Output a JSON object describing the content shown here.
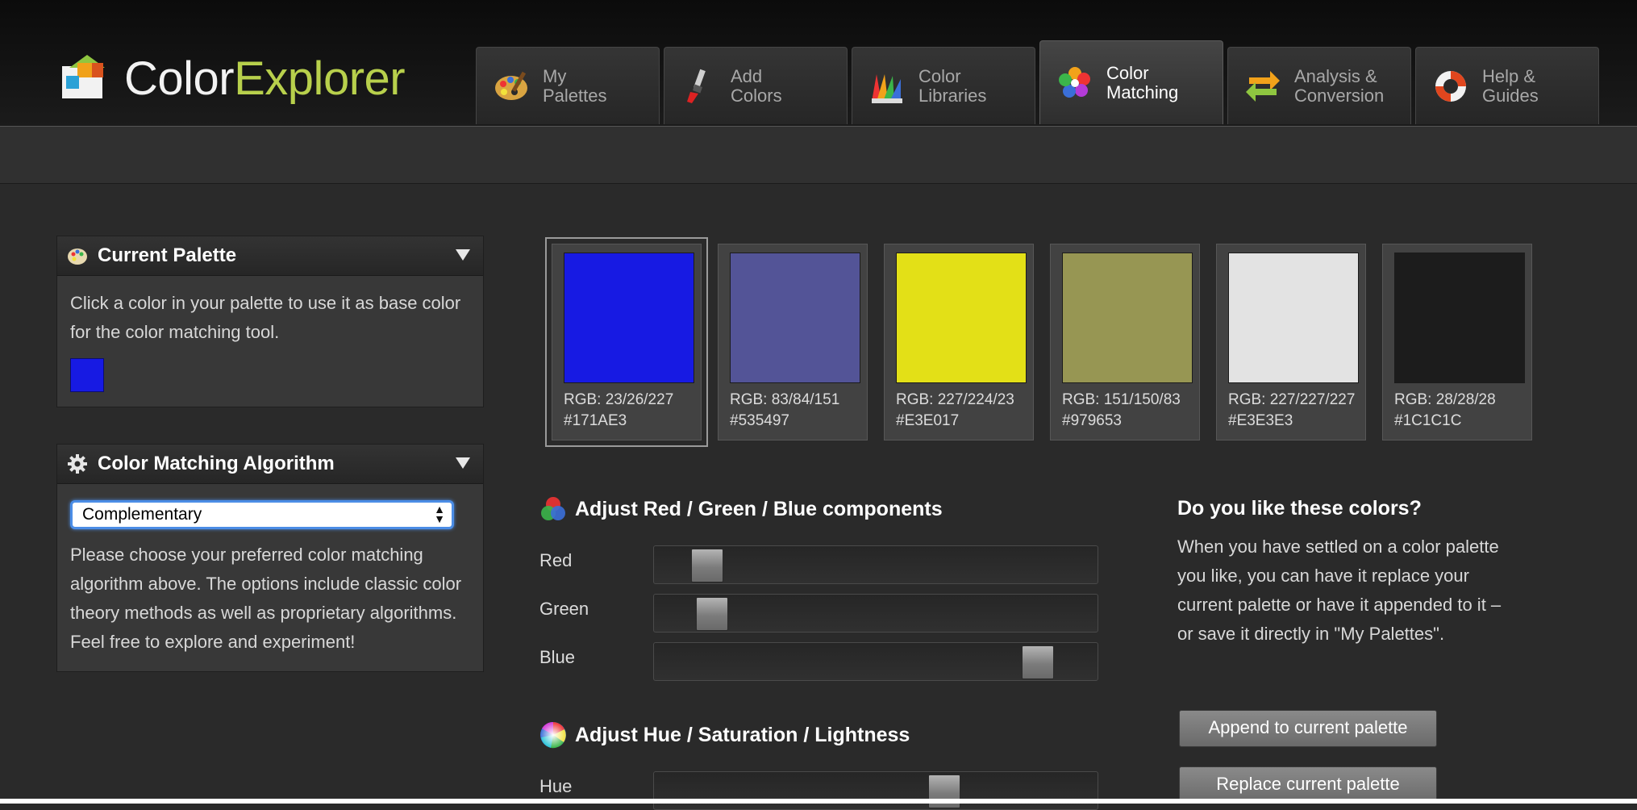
{
  "app": {
    "logo_part1": "Color",
    "logo_part2": "Explorer"
  },
  "tabs": [
    {
      "line1": "My",
      "line2": "Palettes",
      "icon": "palette-icon",
      "active": false
    },
    {
      "line1": "Add",
      "line2": "Colors",
      "icon": "paintbrush-icon",
      "active": false
    },
    {
      "line1": "Color",
      "line2": "Libraries",
      "icon": "color-fan-icon",
      "active": false
    },
    {
      "line1": "Color",
      "line2": "Matching",
      "icon": "flower-icon",
      "active": true
    },
    {
      "line1": "Analysis &",
      "line2": "Conversion",
      "icon": "convert-arrows-icon",
      "active": false
    },
    {
      "line1": "Help &",
      "line2": "Guides",
      "icon": "lifebuoy-icon",
      "active": false
    }
  ],
  "current_palette": {
    "title": "Current Palette",
    "text": "Click a color in your palette to use it as base color for the color matching tool.",
    "base_color": "#171AE3"
  },
  "algorithm": {
    "title": "Color Matching Algorithm",
    "selected": "Complementary",
    "text": "Please choose your preferred color matching algorithm above. The options include classic color theory methods as well as proprietary algorithms. Feel free to explore and experiment!"
  },
  "swatches": [
    {
      "color": "#171AE3",
      "rgb": "RGB: 23/26/227",
      "hex": "#171AE3",
      "selected": true
    },
    {
      "color": "#535497",
      "rgb": "RGB: 83/84/151",
      "hex": "#535497",
      "selected": false
    },
    {
      "color": "#E3E017",
      "rgb": "RGB: 227/224/23",
      "hex": "#E3E017",
      "selected": false
    },
    {
      "color": "#979653",
      "rgb": "RGB: 151/150/83",
      "hex": "#979653",
      "selected": false
    },
    {
      "color": "#E3E3E3",
      "rgb": "RGB: 227/227/227",
      "hex": "#E3E3E3",
      "selected": false
    },
    {
      "color": "#1C1C1C",
      "rgb": "RGB: 28/28/28",
      "hex": "#1C1C1C",
      "selected": false
    }
  ],
  "rgb_section": {
    "title": "Adjust Red / Green / Blue components",
    "sliders": [
      {
        "label": "Red",
        "value": 23,
        "max": 255
      },
      {
        "label": "Green",
        "value": 26,
        "max": 255
      },
      {
        "label": "Blue",
        "value": 227,
        "max": 255
      }
    ]
  },
  "hsl_section": {
    "title": "Adjust Hue / Saturation / Lightness",
    "sliders": [
      {
        "label": "Hue",
        "value": 239,
        "max": 360
      }
    ]
  },
  "like_box": {
    "title": "Do you like these colors?",
    "text": "When you have settled on a color palette you like, you can have it replace your current palette or have it appended to it – or save it directly in \"My Palettes\".",
    "append_label": "Append to current palette",
    "replace_label": "Replace current palette"
  }
}
